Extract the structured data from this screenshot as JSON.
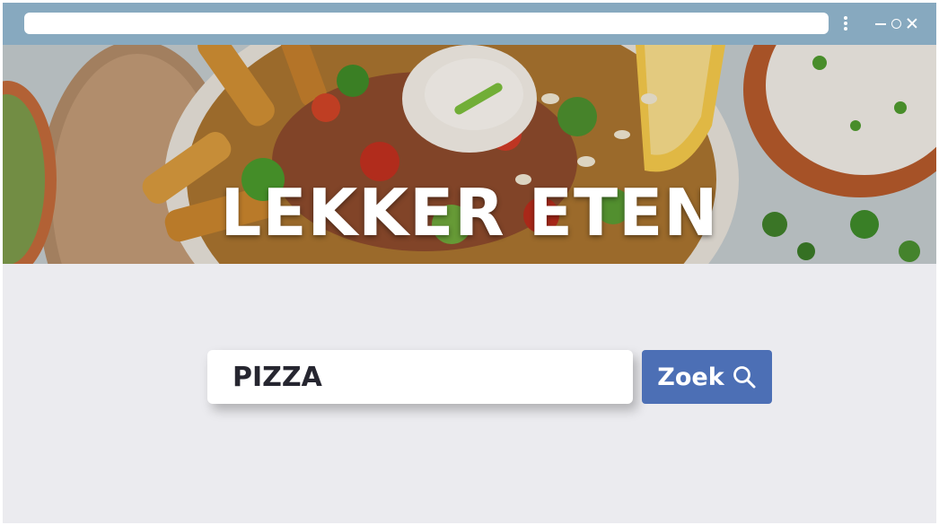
{
  "window": {
    "address_bar_value": ""
  },
  "hero": {
    "title": "LEKKER ETEN"
  },
  "search": {
    "value": "PIZZA",
    "button_label": "Zoek",
    "button_icon": "search-icon"
  },
  "colors": {
    "titlebar": "#87a9bf",
    "background": "#ebebef",
    "button": "#4c6fb5"
  }
}
